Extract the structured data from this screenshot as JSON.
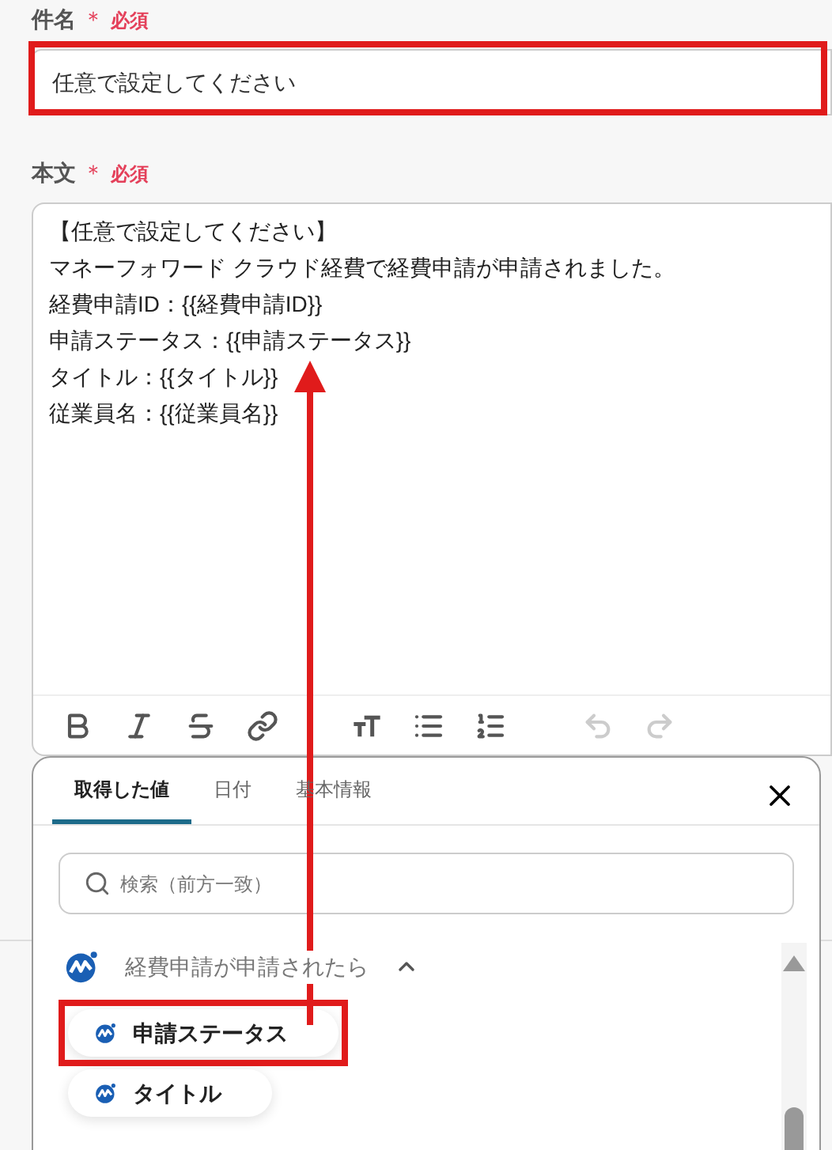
{
  "subject": {
    "label": "件名",
    "required_mark": "＊",
    "required_text": "必須",
    "value": "任意で設定してください"
  },
  "body": {
    "label": "本文",
    "required_mark": "＊",
    "required_text": "必須",
    "lines": [
      "【任意で設定してください】",
      "マネーフォワード クラウド経費で経費申請が申請されました。",
      "経費申請ID：{{経費申請ID}}",
      "申請ステータス：{{申請ステータス}}",
      "タイトル：{{タイトル}}",
      "従業員名：{{従業員名}}"
    ]
  },
  "toolbar": [
    {
      "kind": "bold",
      "disabled": false
    },
    {
      "kind": "italic",
      "disabled": false
    },
    {
      "kind": "strike",
      "disabled": false
    },
    {
      "kind": "link",
      "disabled": false
    },
    {
      "kind": "size",
      "disabled": false
    },
    {
      "kind": "bullets",
      "disabled": false
    },
    {
      "kind": "numbers",
      "disabled": false
    },
    {
      "kind": "undo",
      "disabled": true
    },
    {
      "kind": "redo",
      "disabled": true
    }
  ],
  "picker": {
    "tabs": [
      {
        "label": "取得した値",
        "selected": true
      },
      {
        "label": "日付",
        "selected": false
      },
      {
        "label": "基本情報",
        "selected": false
      }
    ],
    "search": {
      "placeholder": "検索（前方一致）"
    },
    "group": {
      "title": "経費申請が申請されたら",
      "expanded": true,
      "items": [
        {
          "label": "申請ステータス",
          "highlighted": true
        },
        {
          "label": "タイトル",
          "highlighted": false
        }
      ]
    }
  }
}
